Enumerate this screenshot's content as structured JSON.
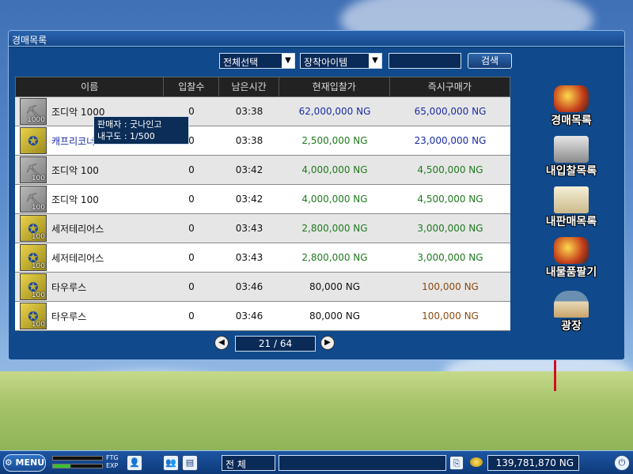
{
  "window": {
    "title": "경매목록"
  },
  "filters": {
    "category": "전체선택",
    "subcategory": "장착아이템",
    "search_value": "",
    "search_button": "검색"
  },
  "table": {
    "headers": [
      "이름",
      "입찰수",
      "남은시간",
      "현재입찰가",
      "즉시구매가"
    ],
    "rows": [
      {
        "icon": "pickaxe-icon",
        "qty": "1000",
        "name": "조디악 1000",
        "bids": "0",
        "time": "03:38",
        "current": "62,000,000 NG",
        "buyout": "65,000,000 NG",
        "current_color": "blue",
        "buyout_color": "blue",
        "name_color": "dark"
      },
      {
        "icon": "capricornus-icon",
        "qty": "",
        "name": "캐프리코너스",
        "bids": "0",
        "time": "03:38",
        "current": "2,500,000 NG",
        "buyout": "23,000,000 NG",
        "current_color": "green",
        "buyout_color": "blue",
        "name_color": "blue"
      },
      {
        "icon": "pickaxe-icon",
        "qty": "100",
        "name": "조디악 100",
        "bids": "0",
        "time": "03:42",
        "current": "4,000,000 NG",
        "buyout": "4,500,000 NG",
        "current_color": "green",
        "buyout_color": "green",
        "name_color": "dark"
      },
      {
        "icon": "pickaxe-icon",
        "qty": "100",
        "name": "조디악 100",
        "bids": "0",
        "time": "03:42",
        "current": "4,000,000 NG",
        "buyout": "4,500,000 NG",
        "current_color": "green",
        "buyout_color": "green",
        "name_color": "dark"
      },
      {
        "icon": "sagittarius-icon",
        "qty": "100",
        "name": "세저테리어스",
        "bids": "0",
        "time": "03:43",
        "current": "2,800,000 NG",
        "buyout": "3,000,000 NG",
        "current_color": "green",
        "buyout_color": "green",
        "name_color": "dark"
      },
      {
        "icon": "sagittarius-icon",
        "qty": "100",
        "name": "세저테리어스",
        "bids": "0",
        "time": "03:43",
        "current": "2,800,000 NG",
        "buyout": "3,000,000 NG",
        "current_color": "green",
        "buyout_color": "green",
        "name_color": "dark"
      },
      {
        "icon": "taurus-icon",
        "qty": "100",
        "name": "타우루스",
        "bids": "0",
        "time": "03:46",
        "current": "80,000 NG",
        "buyout": "100,000 NG",
        "current_color": "dark",
        "buyout_color": "brown",
        "name_color": "dark"
      },
      {
        "icon": "taurus-icon",
        "qty": "100",
        "name": "타우루스",
        "bids": "0",
        "time": "03:46",
        "current": "80,000 NG",
        "buyout": "100,000 NG",
        "current_color": "dark",
        "buyout_color": "brown",
        "name_color": "dark"
      }
    ]
  },
  "tooltip": {
    "seller": "판매자 : 굿나인고",
    "durability": "내구도 : 1/500"
  },
  "pager": {
    "text": "21 / 64"
  },
  "sidemenu": {
    "items": [
      {
        "label": "경매목록",
        "icon": "auction-list-icon"
      },
      {
        "label": "내입찰목록",
        "icon": "my-bids-icon"
      },
      {
        "label": "내판매목록",
        "icon": "my-sales-icon"
      },
      {
        "label": "내물품팔기",
        "icon": "sell-item-icon"
      },
      {
        "label": "광장",
        "icon": "plaza-icon"
      }
    ]
  },
  "taskbar": {
    "menu_label": "MENU",
    "ftg_label": "FTG",
    "exp_label": "EXP",
    "ftg_value": 0.0,
    "exp_value": 0.35,
    "chat_channel": "전    체",
    "chat_value": "",
    "money": "139,781,870 NG"
  },
  "colors": {
    "window_bg": "#104a8c",
    "blue_price": "#1a2ca8",
    "green_price": "#1f7a1f",
    "brown_price": "#8a4a10"
  }
}
